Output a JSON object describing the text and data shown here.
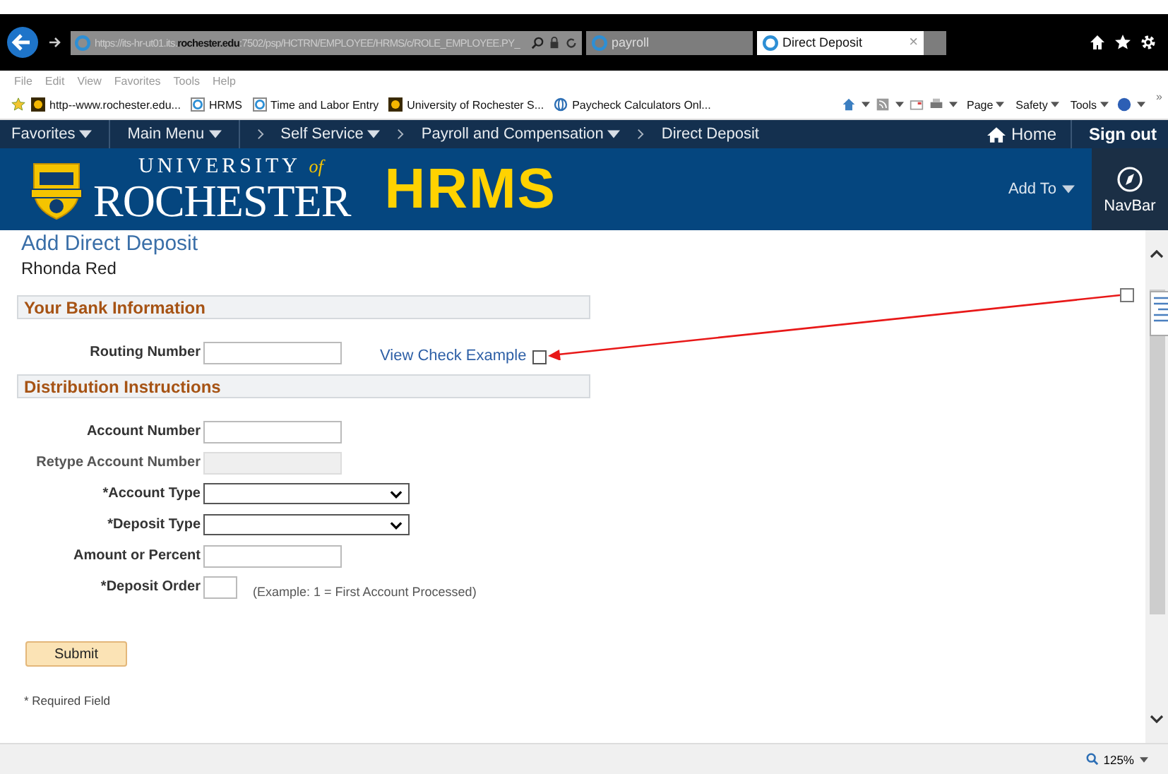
{
  "browser": {
    "url": "https://its-hr-ut01.its.**rochester.edu**:7502/psp/HCTRN/EMPLOYEE/HRMS/c/ROLE_EMPLOYEE.PY_",
    "tabs": [
      {
        "label": "payroll",
        "selected": false
      },
      {
        "label": "Direct Deposit",
        "selected": true,
        "close": "×"
      }
    ],
    "menu": [
      "File",
      "Edit",
      "View",
      "Favorites",
      "Tools",
      "Help"
    ],
    "favorites": [
      {
        "label": "http--www.rochester.edu...",
        "kind": "sun"
      },
      {
        "label": "HRMS",
        "kind": "ie"
      },
      {
        "label": "Time and Labor Entry",
        "kind": "ie"
      },
      {
        "label": "University of Rochester  S...",
        "kind": "sun"
      },
      {
        "label": "Paycheck Calculators  Onl...",
        "kind": "globe"
      }
    ],
    "commands": [
      "Page",
      "Safety",
      "Tools"
    ],
    "chevrons": "»",
    "zoom": "125%"
  },
  "nav": {
    "items": [
      {
        "label": "Favorites",
        "dropdown": true,
        "separator": false
      },
      {
        "label": "Main Menu",
        "dropdown": true,
        "separator": false
      },
      {
        "label": "Self Service",
        "dropdown": true,
        "separator": true
      },
      {
        "label": "Payroll and Compensation",
        "dropdown": true,
        "separator": true
      },
      {
        "label": "Direct Deposit",
        "dropdown": false,
        "separator": true
      }
    ],
    "home": "Home",
    "sign_out": "Sign out"
  },
  "banner": {
    "university_top": "UNIVERSITY",
    "university_of": "of",
    "university_name": "ROCHESTER",
    "app": "HRMS",
    "add_to": "Add To",
    "navbar": "NavBar"
  },
  "page": {
    "title": "Add Direct Deposit",
    "employee": "Rhonda Red",
    "sections": [
      {
        "title": "Your Bank Information",
        "fields": [
          {
            "label": "Routing Number",
            "kind": "text",
            "link": "View Check Example",
            "checked": false
          }
        ]
      },
      {
        "title": "Distribution Instructions",
        "fields": [
          {
            "label": "Account Number",
            "kind": "text"
          },
          {
            "label": "Retype Account Number",
            "kind": "disabled"
          },
          {
            "label": "*Account Type",
            "kind": "select"
          },
          {
            "label": "*Deposit Type",
            "kind": "select"
          },
          {
            "label": "Amount or Percent",
            "kind": "text"
          },
          {
            "label": "*Deposit Order",
            "kind": "small",
            "hint": "(Example: 1 = First Account Processed)"
          }
        ]
      }
    ],
    "submit": "Submit",
    "required_note": "* Required Field"
  }
}
